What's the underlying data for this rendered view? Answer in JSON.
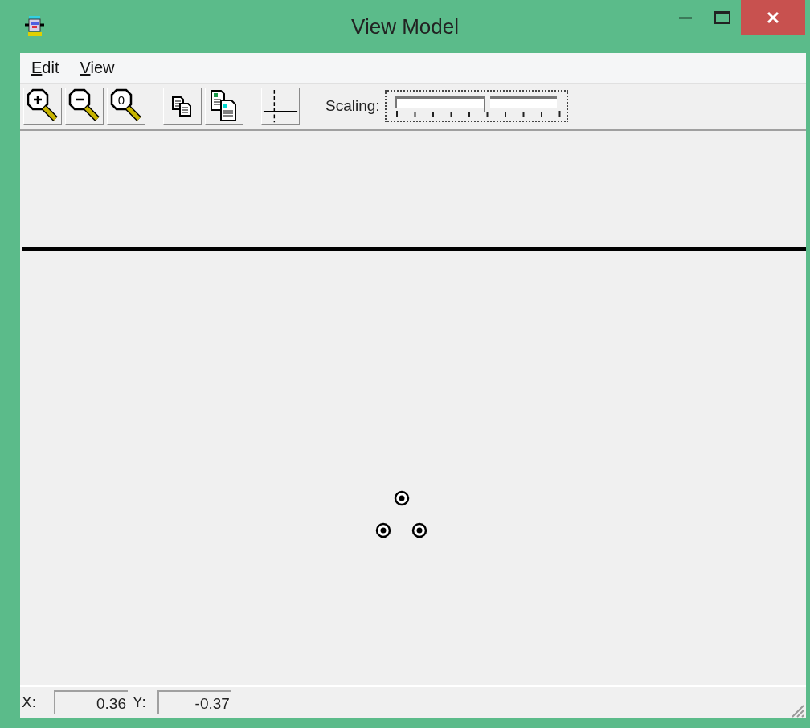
{
  "window": {
    "title": "View Model"
  },
  "menu": [
    {
      "label": "Edit"
    },
    {
      "label": "View"
    }
  ],
  "toolbar": [
    {
      "kind": "zoom-in"
    },
    {
      "kind": "zoom-out"
    },
    {
      "kind": "zoom-reset",
      "glyph": "0"
    },
    {
      "kind": "sep"
    },
    {
      "kind": "copy"
    },
    {
      "kind": "paste"
    },
    {
      "kind": "sep"
    },
    {
      "kind": "axes"
    }
  ],
  "scaling": {
    "label": "Scaling:",
    "level": 0.56
  },
  "status_bar": {
    "x_label": "X:",
    "x_value": "0.36",
    "y_label": "Y:",
    "y_value": "-0.37"
  }
}
